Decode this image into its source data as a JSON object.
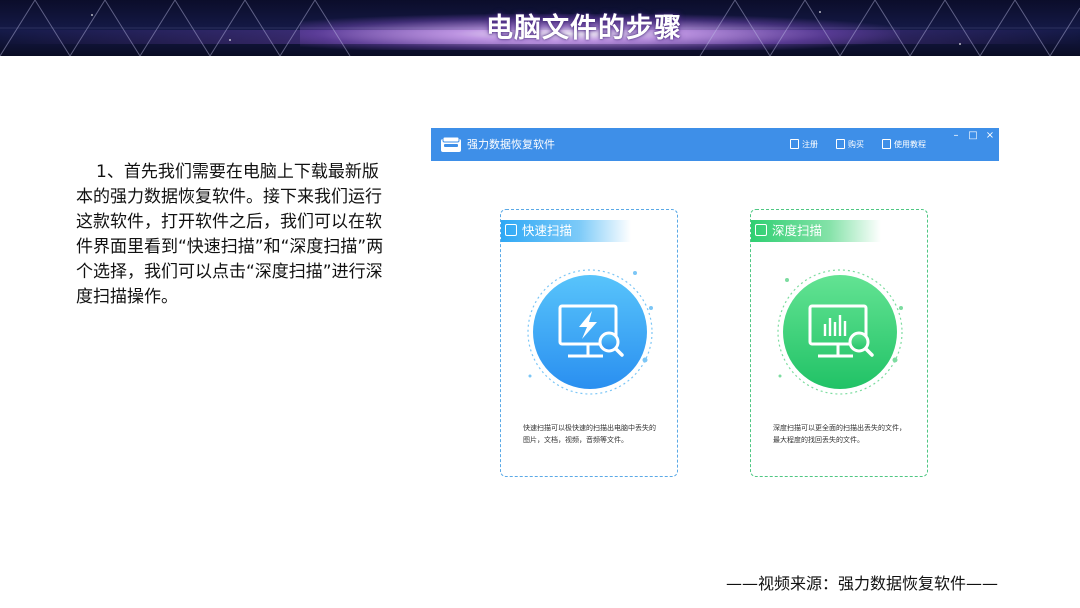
{
  "slide": {
    "title": "电脑文件的步骤",
    "step_text": "1、首先我们需要在电脑上下载最新版本的强力数据恢复软件。接下来我们运行这款软件，打开软件之后，我们可以在软件界面里看到“快速扫描”和“深度扫描”两个选择，我们可以点击“深度扫描”进行深度扫描操作。",
    "credit": "——视频来源：强力数据恢复软件——"
  },
  "app": {
    "name": "强力数据恢复软件",
    "toolbar": {
      "register_label": "注册",
      "buy_label": "购买",
      "tutorial_label": "使用教程"
    },
    "window_controls": {
      "minimize": "–",
      "maximize": "□",
      "close": "×"
    },
    "quick_scan": {
      "title": "快速扫描",
      "description": "快速扫描可以极快速的扫描出电脑中丢失的图片，文档，视频，音频等文件。",
      "accent": "#2fa8f5"
    },
    "deep_scan": {
      "title": "深度扫描",
      "description": "深度扫描可以更全面的扫描出丢失的文件，最大程度的找回丢失的文件。",
      "accent": "#2fcf72"
    },
    "titlebar_color": "#3e8fe8"
  }
}
